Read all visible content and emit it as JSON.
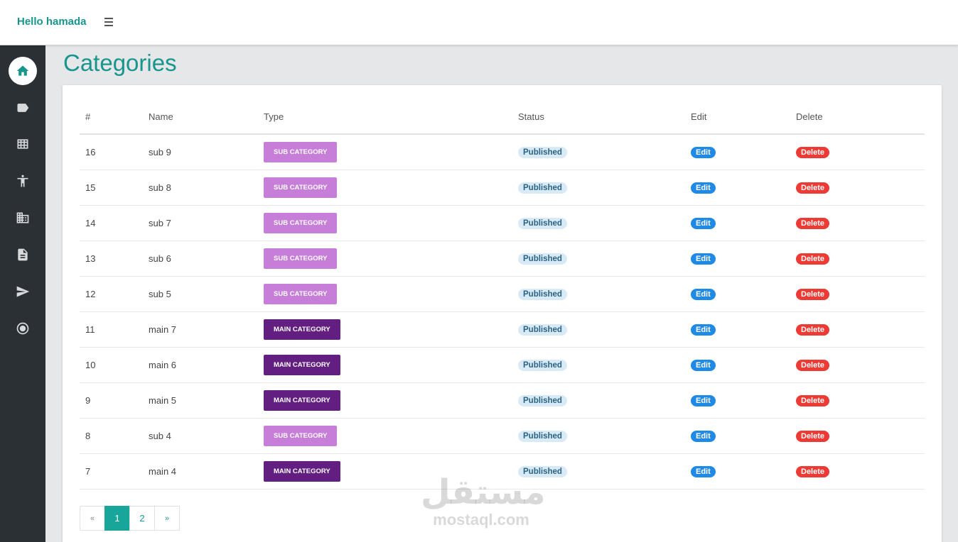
{
  "header": {
    "brand": "Hello hamada"
  },
  "sidebar": {
    "items": [
      {
        "icon": "home-icon",
        "active": true
      },
      {
        "icon": "tag-icon",
        "active": false
      },
      {
        "icon": "table-icon",
        "active": false
      },
      {
        "icon": "accessibility-icon",
        "active": false
      },
      {
        "icon": "building-icon",
        "active": false
      },
      {
        "icon": "document-icon",
        "active": false
      },
      {
        "icon": "send-icon",
        "active": false
      },
      {
        "icon": "radio-button-icon",
        "active": false
      }
    ]
  },
  "page": {
    "title": "Categories"
  },
  "table": {
    "headers": {
      "id": "#",
      "name": "Name",
      "type": "Type",
      "status": "Status",
      "edit": "Edit",
      "delete": "Delete"
    },
    "rows": [
      {
        "id": "16",
        "name": "sub 9",
        "type": "SUB CATEGORY",
        "kind": "sub",
        "status": "Published",
        "edit": "Edit",
        "delete": "Delete"
      },
      {
        "id": "15",
        "name": "sub 8",
        "type": "SUB CATEGORY",
        "kind": "sub",
        "status": "Published",
        "edit": "Edit",
        "delete": "Delete"
      },
      {
        "id": "14",
        "name": "sub 7",
        "type": "SUB CATEGORY",
        "kind": "sub",
        "status": "Published",
        "edit": "Edit",
        "delete": "Delete"
      },
      {
        "id": "13",
        "name": "sub 6",
        "type": "SUB CATEGORY",
        "kind": "sub",
        "status": "Published",
        "edit": "Edit",
        "delete": "Delete"
      },
      {
        "id": "12",
        "name": "sub 5",
        "type": "SUB CATEGORY",
        "kind": "sub",
        "status": "Published",
        "edit": "Edit",
        "delete": "Delete"
      },
      {
        "id": "11",
        "name": "main 7",
        "type": "MAIN CATEGORY",
        "kind": "main",
        "status": "Published",
        "edit": "Edit",
        "delete": "Delete"
      },
      {
        "id": "10",
        "name": "main 6",
        "type": "MAIN CATEGORY",
        "kind": "main",
        "status": "Published",
        "edit": "Edit",
        "delete": "Delete"
      },
      {
        "id": "9",
        "name": "main 5",
        "type": "MAIN CATEGORY",
        "kind": "main",
        "status": "Published",
        "edit": "Edit",
        "delete": "Delete"
      },
      {
        "id": "8",
        "name": "sub 4",
        "type": "SUB CATEGORY",
        "kind": "sub",
        "status": "Published",
        "edit": "Edit",
        "delete": "Delete"
      },
      {
        "id": "7",
        "name": "main 4",
        "type": "MAIN CATEGORY",
        "kind": "main",
        "status": "Published",
        "edit": "Edit",
        "delete": "Delete"
      }
    ]
  },
  "pagination": {
    "prev": "«",
    "pages": [
      "1",
      "2"
    ],
    "current": "1",
    "next": "»"
  },
  "watermark": {
    "arabic": "مستقل",
    "latin": "mostaql.com"
  },
  "colors": {
    "accent": "#18968d",
    "sidebar": "#2b3034",
    "sub_category": "#c67ed9",
    "main_category": "#621e81",
    "edit": "#1f8ae6",
    "delete": "#ec3b35",
    "published_bg": "#d9eaf7"
  }
}
